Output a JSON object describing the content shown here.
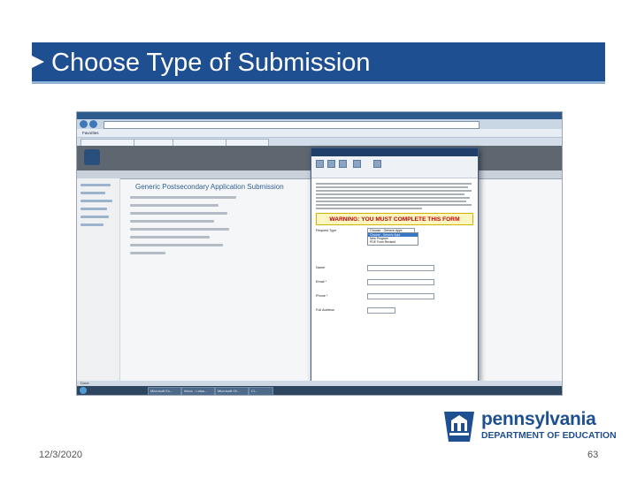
{
  "slide": {
    "title": "Choose Type of Submission",
    "date": "12/3/2020",
    "page_number": "63",
    "accent_color": "#1e4f91"
  },
  "logo": {
    "name": "pennsylvania",
    "department": "DEPARTMENT OF EDUCATION"
  },
  "screenshot": {
    "favorites": "Favorites",
    "main_heading": "Generic Postsecondary Application Submission",
    "status": "Done",
    "taskbar_items": [
      "Microsoft Ex...",
      "Inbox - Lotus...",
      "Microsoft Of...",
      "Cl..."
    ],
    "dialog": {
      "warning_title": "WARNING: YOU MUST COMPLETE THIS FORM",
      "form": {
        "request_type_label": "Request Type",
        "request_type_value": "Choose - Generic Appr.",
        "request_type_options": [
          "Choose - Generic Appr.",
          "New Program",
          "PDE Form Revised"
        ],
        "name_label": "Name",
        "name_input": "",
        "email_label": "Email *",
        "phone_label": "Phone *",
        "full_address_label": "Full Address"
      }
    }
  }
}
